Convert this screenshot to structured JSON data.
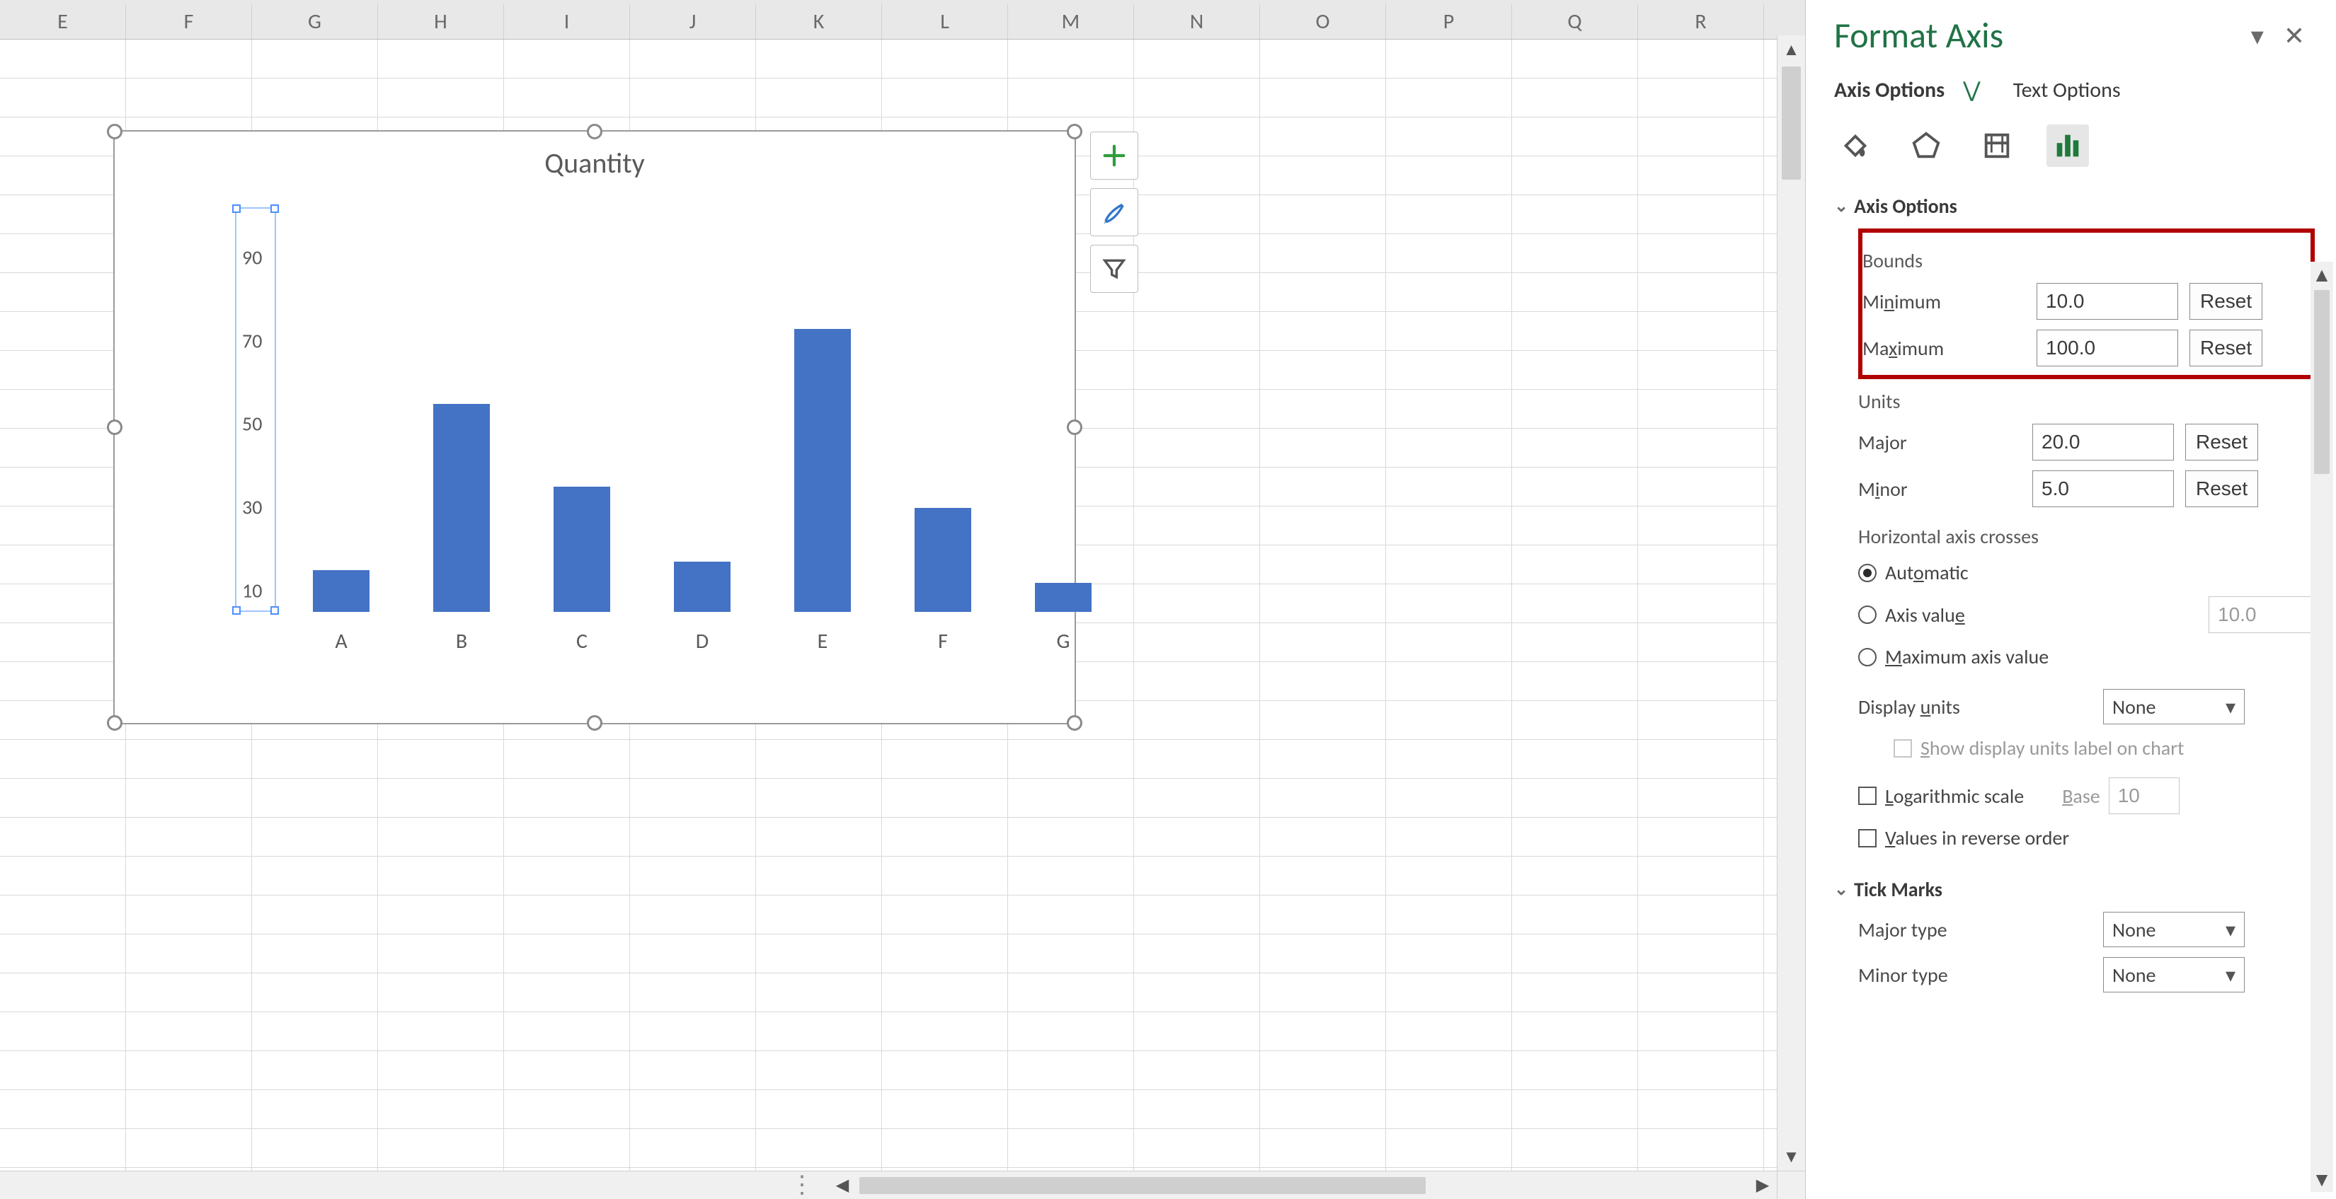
{
  "columns": [
    "E",
    "F",
    "G",
    "H",
    "I",
    "J",
    "K",
    "L",
    "M",
    "N",
    "O",
    "P",
    "Q",
    "R"
  ],
  "chart_buttons": [
    "plus",
    "brush",
    "filter"
  ],
  "pane": {
    "title": "Format Axis",
    "tabs": {
      "axis_options": "Axis Options",
      "text_options": "Text Options"
    },
    "icons": [
      "fill",
      "pentagon",
      "size",
      "bars"
    ],
    "section_axis_options": "Axis Options",
    "bounds_label": "Bounds",
    "min_label": "Minimum",
    "min_value": "10.0",
    "min_reset": "Reset",
    "max_label": "Maximum",
    "max_value": "100.0",
    "max_reset": "Reset",
    "units_label": "Units",
    "major_label": "Major",
    "major_value": "20.0",
    "major_reset": "Reset",
    "minor_label": "Minor",
    "minor_value": "5.0",
    "minor_reset": "Reset",
    "hcrosses_label": "Horizontal axis crosses",
    "auto_label": "Automatic",
    "axis_value_label": "Axis value",
    "axis_value_value": "10.0",
    "max_axis_value_label": "Maximum axis value",
    "display_units_label": "Display units",
    "display_units_value": "None",
    "show_dul_label": "Show display units label on chart",
    "log_label": "Logarithmic scale",
    "log_base_label": "Base",
    "log_base_value": "10",
    "reverse_label": "Values in reverse order",
    "tickmarks_header": "Tick Marks",
    "major_type_label": "Major type",
    "major_type_value": "None",
    "minor_type_label": "Minor type",
    "minor_type_value": "None"
  },
  "chart_data": {
    "type": "bar",
    "title": "Quantity",
    "categories": [
      "A",
      "B",
      "C",
      "D",
      "E",
      "F",
      "G"
    ],
    "values": [
      20,
      60,
      40,
      22,
      78,
      35,
      17
    ],
    "y_ticks": [
      10,
      30,
      50,
      70,
      90
    ],
    "ylim": [
      10,
      100
    ],
    "xlabel": "",
    "ylabel": ""
  }
}
